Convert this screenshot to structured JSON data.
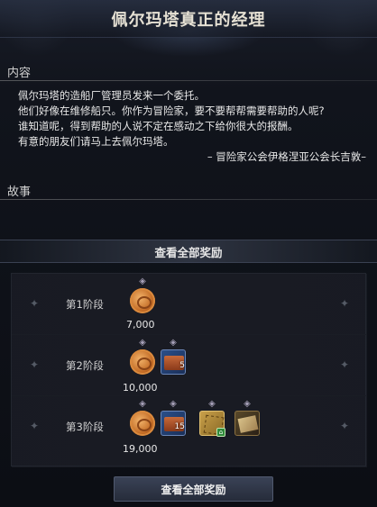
{
  "window": {
    "title": "佩尔玛塔真正的经理"
  },
  "content": {
    "label": "内容",
    "lines": [
      "佩尔玛塔的造船厂管理员发来一个委托。",
      "他们好像在维修船只。你作为冒险家，要不要帮帮需要帮助的人呢?",
      "谁知道呢，得到帮助的人说不定在感动之下给你很大的报酬。",
      "有意的朋友们请马上去佩尔玛塔。"
    ],
    "signature": "– 冒险家公会伊格涅亚公会长吉敦–"
  },
  "story": {
    "label": "故事"
  },
  "rewards": {
    "view_all_top": "查看全部奖励",
    "view_all_bottom": "查看全部奖励",
    "stages": [
      {
        "label": "第1阶段",
        "items": [
          {
            "icon": "silver-coin-icon",
            "amount": "7,000"
          }
        ]
      },
      {
        "label": "第2阶段",
        "items": [
          {
            "icon": "silver-coin-icon",
            "amount": "10,000"
          },
          {
            "icon": "skill-book-icon",
            "qty": "5"
          }
        ]
      },
      {
        "label": "第3阶段",
        "items": [
          {
            "icon": "silver-coin-icon",
            "amount": "19,000"
          },
          {
            "icon": "skill-book-icon",
            "qty": "15"
          },
          {
            "icon": "map-scroll-icon"
          },
          {
            "icon": "parchment-icon"
          }
        ]
      }
    ]
  }
}
